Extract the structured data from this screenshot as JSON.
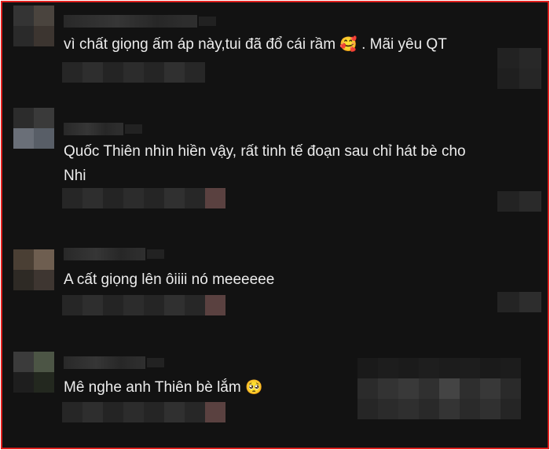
{
  "comments": [
    {
      "text": "vì chất giọng ấm áp này,tui đã đổ cái rầm",
      "emoji": "🥰",
      "suffix": ". Mãi yêu QT"
    },
    {
      "text": "Quốc Thiên nhìn hiền vậy, rất tinh tế đoạn sau chỉ hát bè cho Nhi",
      "emoji": "",
      "suffix": ""
    },
    {
      "text": "A cất giọng lên ôiiii nó meeeeee",
      "emoji": "",
      "suffix": ""
    },
    {
      "text": "Mê nghe anh Thiên bè lắm",
      "emoji": "🥺",
      "suffix": ""
    }
  ]
}
